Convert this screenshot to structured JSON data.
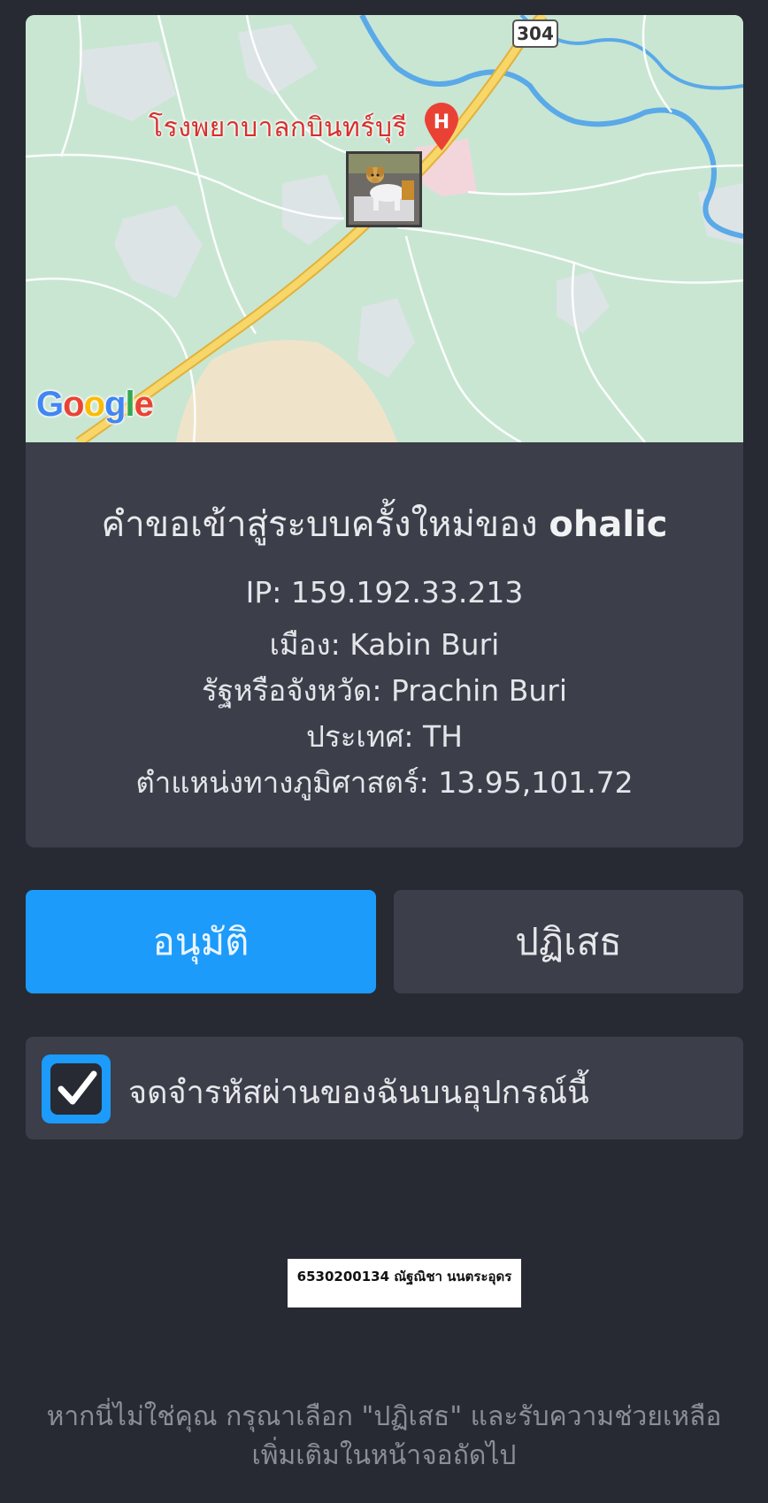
{
  "map": {
    "place_label": "โรงพยาบาลกบินทร์บุรี",
    "road_number": "304",
    "hospital_marker": "H",
    "attribution": "Google",
    "colors": {
      "land": "#c9e6d3",
      "road": "#f3c94b",
      "water": "#5aa9e8",
      "marker": "#e94235"
    }
  },
  "request": {
    "title_prefix": "คำขอเข้าสู่ระบบครั้งใหม่ของ",
    "username": "ohalic",
    "ip": "IP: 159.192.33.213",
    "city": "เมือง: Kabin Buri",
    "region": "รัฐหรือจังหวัด: Prachin Buri",
    "country": "ประเทศ: TH",
    "geo": "ตำแหน่งทางภูมิศาสตร์: 13.95,101.72"
  },
  "actions": {
    "approve_label": "อนุมัติ",
    "deny_label": "ปฏิเสธ"
  },
  "remember": {
    "checked": true,
    "label": "จดจำรหัสผ่านของฉันบนอุปกรณ์นี้"
  },
  "name_tag": "6530200134 ณัฐณิชา  นนตระอุดร",
  "footer": {
    "line1": "หากนี่ไม่ใช่คุณ กรุณาเลือก \"ปฏิเสธ\" และรับความช่วยเหลือ",
    "line2": "เพิ่มเติมในหน้าจอถัดไป"
  },
  "theme": {
    "background": "#272a33",
    "panel": "#3c3e49",
    "accent": "#1c9bfb"
  }
}
